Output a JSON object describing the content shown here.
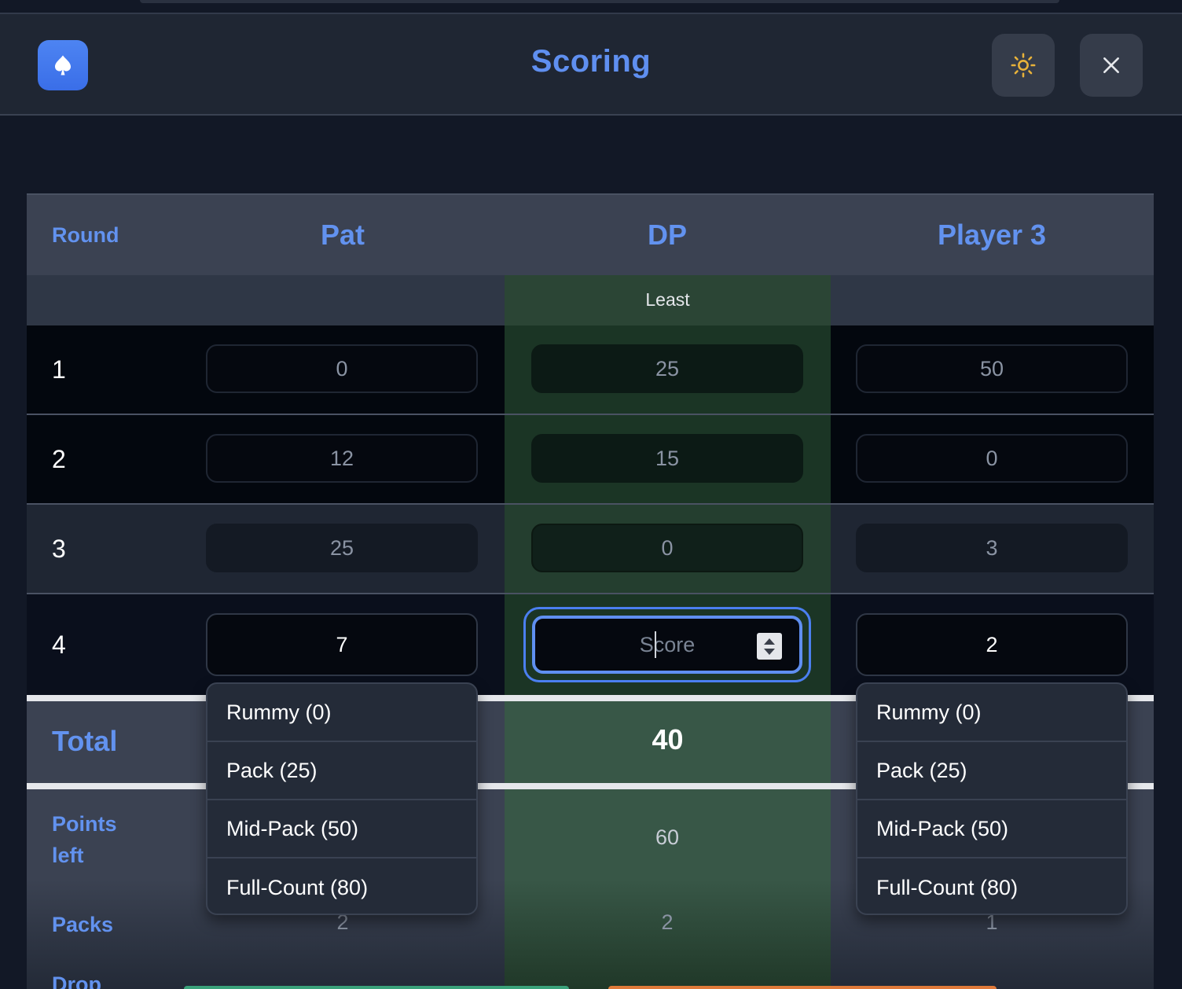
{
  "header": {
    "title": "Scoring",
    "app_icon": "spade-icon",
    "theme_icon": "sun-icon",
    "close_icon": "close-icon",
    "accent_color": "#5f8ff0",
    "theme_icon_color": "#e8b23a"
  },
  "table": {
    "round_header": "Round",
    "players": [
      "Pat",
      "DP",
      "Player 3"
    ],
    "least_label": "Least",
    "least_color": "#2b4535",
    "rounds": [
      {
        "round": "1",
        "scores": [
          "0",
          "25",
          "50"
        ]
      },
      {
        "round": "2",
        "scores": [
          "12",
          "15",
          "0"
        ]
      },
      {
        "round": "3",
        "scores": [
          "25",
          "0",
          "3"
        ]
      },
      {
        "round": "4",
        "scores": [
          "7",
          "",
          "2"
        ]
      }
    ],
    "active_input_placeholder": "Score",
    "total_label": "Total",
    "totals": [
      "",
      "40",
      ""
    ],
    "points_left_label": "Points left",
    "points_left": [
      "",
      "60",
      ""
    ],
    "packs_label": "Packs",
    "packs": [
      "2",
      "2",
      "1"
    ],
    "partial_label": "Drop"
  },
  "dropdown_options": [
    "Rummy (0)",
    "Pack (25)",
    "Mid-Pack (50)",
    "Full-Count (80)"
  ]
}
